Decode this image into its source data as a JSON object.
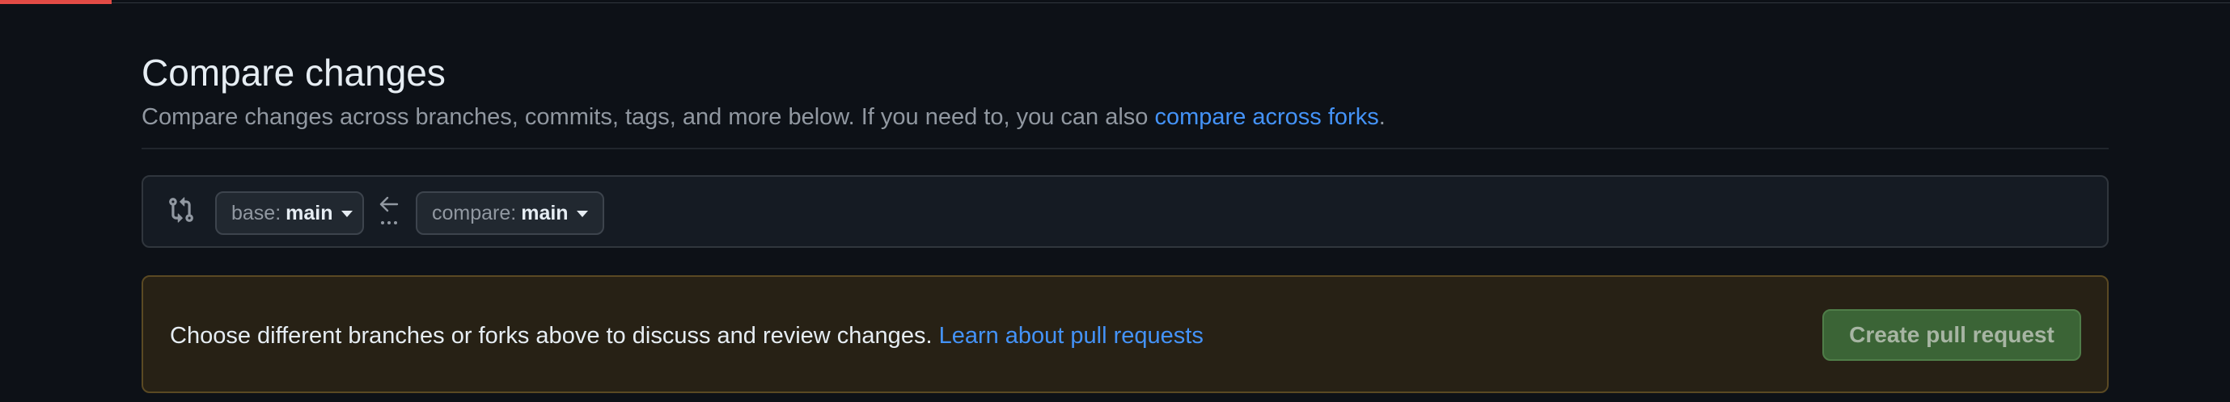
{
  "loading_progress_percent": 5,
  "page": {
    "title": "Compare changes",
    "subtitle_text": "Compare changes across branches, commits, tags, and more below. If you need to, you can also ",
    "subtitle_link": "compare across forks",
    "subtitle_end": "."
  },
  "compare": {
    "icon": "git-compare-icon",
    "base_prefix": "base:",
    "base_branch": "main",
    "compare_prefix": "compare:",
    "compare_branch": "main",
    "arrow_icon": "arrow-left-icon",
    "dots_icon": "ellipsis-icon"
  },
  "flash": {
    "message": "Choose different branches or forks above to discuss and review changes. ",
    "link": "Learn about pull requests",
    "button_label": "Create pull request"
  },
  "colors": {
    "background": "#0d1117",
    "link": "#4493f8",
    "progress": "#f85149",
    "flash_bg": "#272115",
    "button_bg": "#3b6436"
  }
}
